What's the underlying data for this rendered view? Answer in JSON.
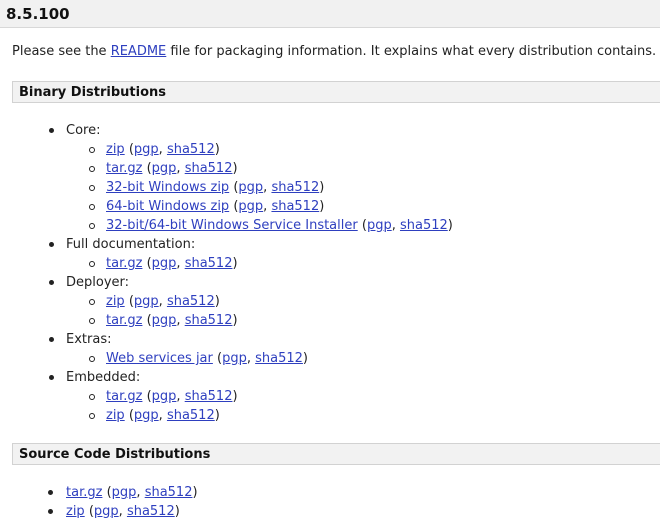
{
  "version": "8.5.100",
  "intro": {
    "prefix": "Please see the ",
    "link": "README",
    "suffix": " file for packaging information. It explains what every distribution contains."
  },
  "binary": {
    "title": "Binary Distributions",
    "groups": [
      {
        "label": "Core:",
        "items": [
          {
            "name": "zip",
            "pgp": "pgp",
            "sha": "sha512"
          },
          {
            "name": "tar.gz",
            "pgp": "pgp",
            "sha": "sha512"
          },
          {
            "name": "32-bit Windows zip",
            "pgp": "pgp",
            "sha": "sha512"
          },
          {
            "name": "64-bit Windows zip",
            "pgp": "pgp",
            "sha": "sha512"
          },
          {
            "name": "32-bit/64-bit Windows Service Installer",
            "pgp": "pgp",
            "sha": "sha512"
          }
        ]
      },
      {
        "label": "Full documentation:",
        "items": [
          {
            "name": "tar.gz",
            "pgp": "pgp",
            "sha": "sha512"
          }
        ]
      },
      {
        "label": "Deployer:",
        "items": [
          {
            "name": "zip",
            "pgp": "pgp",
            "sha": "sha512"
          },
          {
            "name": "tar.gz",
            "pgp": "pgp",
            "sha": "sha512"
          }
        ]
      },
      {
        "label": "Extras:",
        "items": [
          {
            "name": "Web services jar",
            "pgp": "pgp",
            "sha": "sha512"
          }
        ]
      },
      {
        "label": "Embedded:",
        "items": [
          {
            "name": "tar.gz",
            "pgp": "pgp",
            "sha": "sha512"
          },
          {
            "name": "zip",
            "pgp": "pgp",
            "sha": "sha512"
          }
        ]
      }
    ]
  },
  "source": {
    "title": "Source Code Distributions",
    "items": [
      {
        "name": "tar.gz",
        "pgp": "pgp",
        "sha": "sha512"
      },
      {
        "name": "zip",
        "pgp": "pgp",
        "sha": "sha512"
      }
    ]
  }
}
